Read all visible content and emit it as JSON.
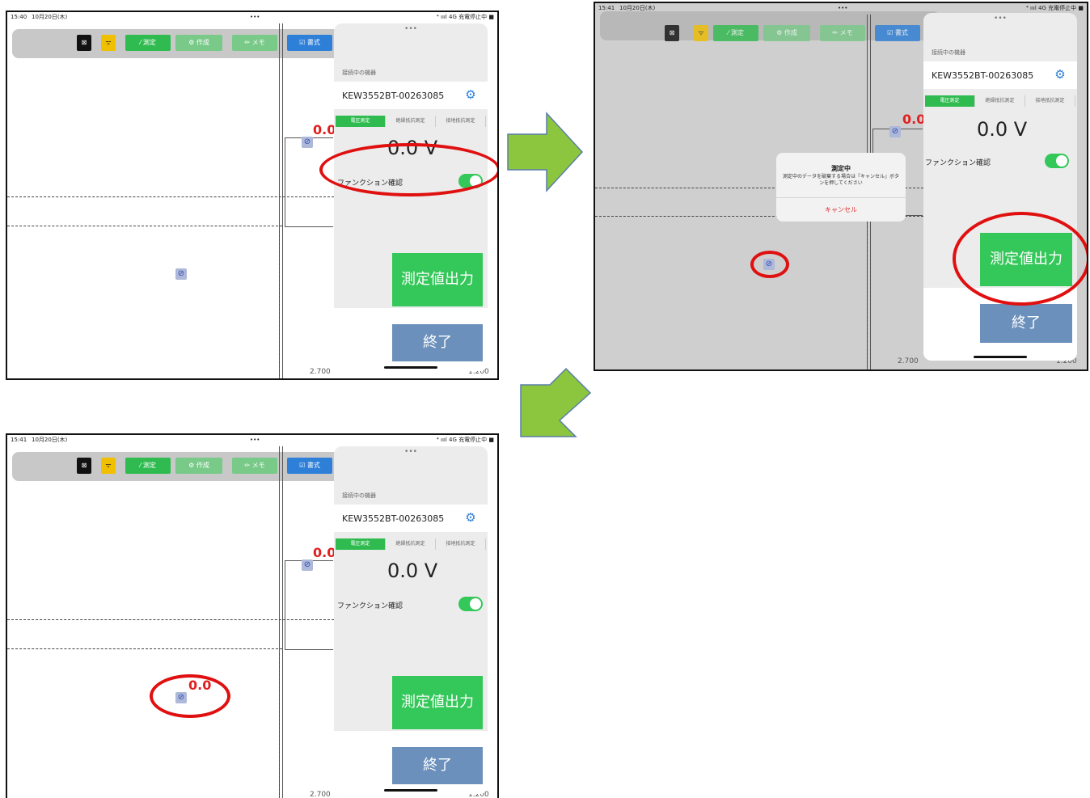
{
  "status": {
    "time_1": "15:40",
    "time_2": "15:41",
    "time_3": "15:41",
    "date": "10月20日(木)",
    "dots": "•••",
    "right": "⁴ ıııl 4G 充電停止中 ■"
  },
  "toolbar": {
    "close_label": "⊠",
    "wifi_label": "ᯤ",
    "measure_label": "⁄ 測定",
    "create_label": "⚙ 作成",
    "memo_label": "✏ メモ",
    "format_label": "☑ 書式"
  },
  "panel": {
    "dots": "•••",
    "connected_label": "接続中の機器",
    "device_name": "KEW3552BT-00263085",
    "tabs": [
      "電圧測定",
      "絶縁抵抗測定",
      "接地抵抗測定"
    ],
    "voltage": "0.0 V",
    "function_label": "ファンクション確認",
    "function_on": true,
    "output_button": "測定値出力",
    "end_button": "終了"
  },
  "canvas": {
    "measured_value": "0.0",
    "scale_left": "2.700",
    "scale_right": "1.200"
  },
  "dialog": {
    "title": "測定中",
    "message": "測定中のデータを破棄する場合は『キャンセル』ボタンを押してください",
    "cancel": "キャンセル"
  },
  "colors": {
    "highlight_ring": "#e01010",
    "arrow": "#8cc63f",
    "green": "#34c759",
    "blue_button": "#6b90bc"
  }
}
